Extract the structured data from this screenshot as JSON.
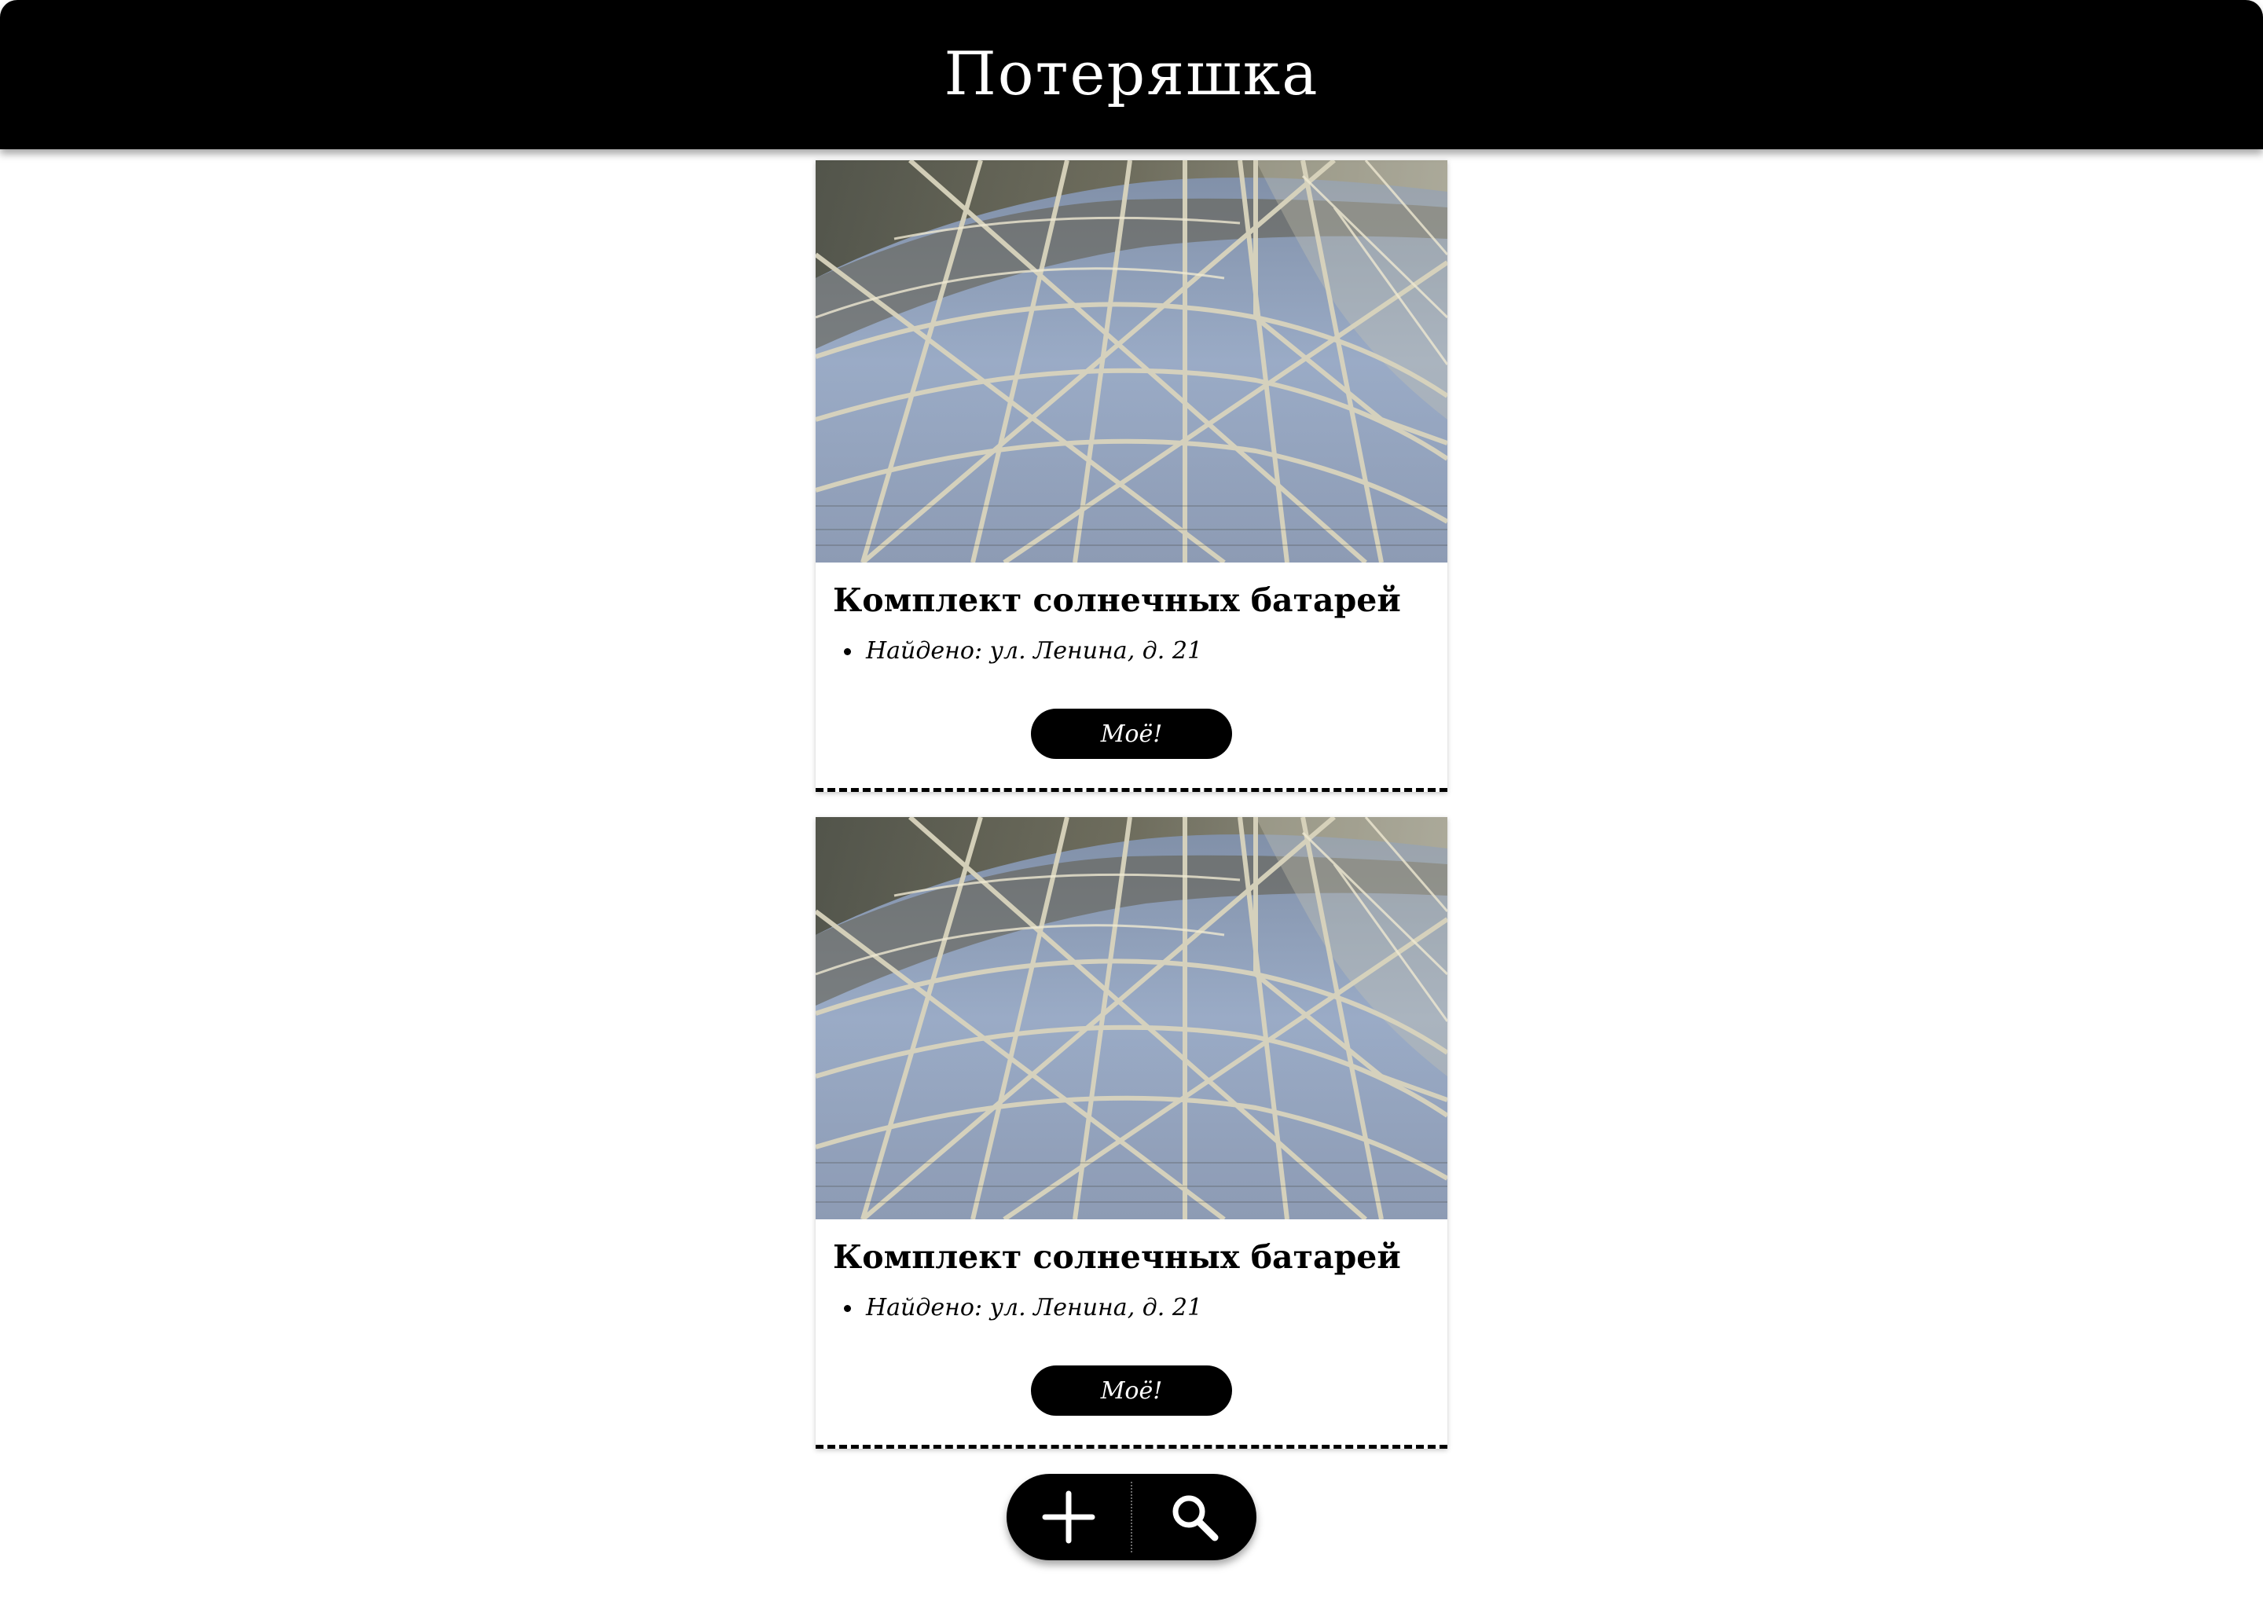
{
  "header": {
    "title": "Потеряшка"
  },
  "items": [
    {
      "title": "Комплект солнечных батарей",
      "found": "Найдено: ул. Ленина, д. 21",
      "claim_label": "Моё!"
    },
    {
      "title": "Комплект солнечных батарей",
      "found": "Найдено: ул. Ленина, д. 21",
      "claim_label": "Моё!"
    }
  ],
  "actions": {
    "add_icon": "plus-icon",
    "search_icon": "search-icon"
  },
  "colors": {
    "header_bg": "#000000",
    "button_bg": "#000000",
    "text": "#000000",
    "page_bg": "#ffffff"
  }
}
